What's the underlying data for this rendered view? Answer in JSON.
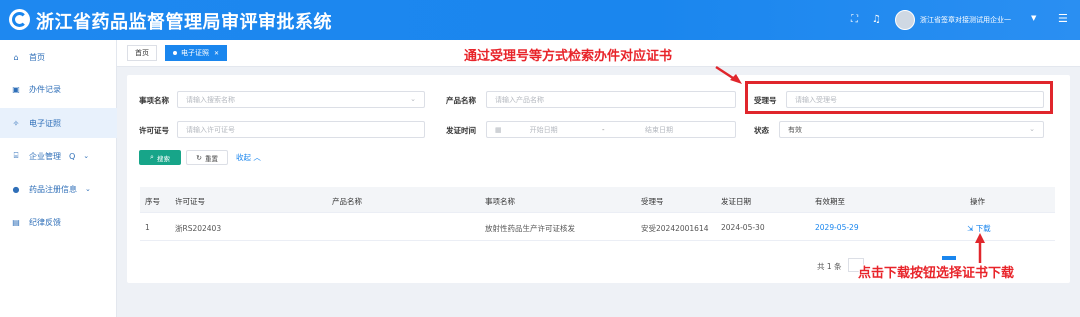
{
  "header": {
    "title": "浙江省药品监督管理局审评审批系统",
    "user_name": "浙江省签章对接测试用企业一",
    "icons": [
      "fullscreen-icon",
      "music-icon",
      "menu-icon"
    ]
  },
  "sidebar": {
    "items": [
      {
        "label": "首页",
        "icon": "home-icon"
      },
      {
        "label": "办件记录",
        "icon": "record-icon"
      },
      {
        "label": "电子证照",
        "icon": "certificate-icon"
      },
      {
        "label": "企业管理",
        "icon": "enterprise-icon",
        "extra": "Q"
      },
      {
        "label": "药品注册信息",
        "icon": "drug-icon"
      },
      {
        "label": "纪律反馈",
        "icon": "feedback-icon"
      }
    ],
    "active_index": 2
  },
  "tabs": [
    {
      "label": "首页"
    },
    {
      "label": "电子证照"
    }
  ],
  "filters": {
    "item_name": {
      "label": "事项名称",
      "placeholder": "请输入搜索名称"
    },
    "product_name": {
      "label": "产品名称",
      "placeholder": "请输入产品名称"
    },
    "accept_no": {
      "label": "受理号",
      "placeholder": "请输入受理号"
    },
    "license_no": {
      "label": "许可证号",
      "placeholder": "请输入许可证号"
    },
    "issue_time": {
      "label": "发证时间",
      "start_placeholder": "开始日期",
      "separator": "-",
      "end_placeholder": "结束日期"
    },
    "status": {
      "label": "状态",
      "value": "有效"
    }
  },
  "buttons": {
    "search": "搜索",
    "reset": "重置",
    "collapse": "收起"
  },
  "table": {
    "columns": [
      "序号",
      "许可证号",
      "产品名称",
      "事项名称",
      "受理号",
      "发证日期",
      "有效期至",
      "操作"
    ],
    "rows": [
      {
        "index": "1",
        "license_no": "浙RS202403",
        "product_name": "",
        "item_name": "放射性药品生产许可证核发",
        "accept_no": "安受20242001614",
        "issue_date": "2024-05-30",
        "expiry": "2029-05-29",
        "action": "下载"
      }
    ]
  },
  "pagination": {
    "total": "共 1 条"
  },
  "annotations": {
    "top": "通过受理号等方式检索办件对应证书",
    "bottom": "点击下载按钮选择证书下载"
  },
  "colors": {
    "header": "#1a86ee",
    "primary_button": "#17a589",
    "annotation": "#e8242a"
  }
}
